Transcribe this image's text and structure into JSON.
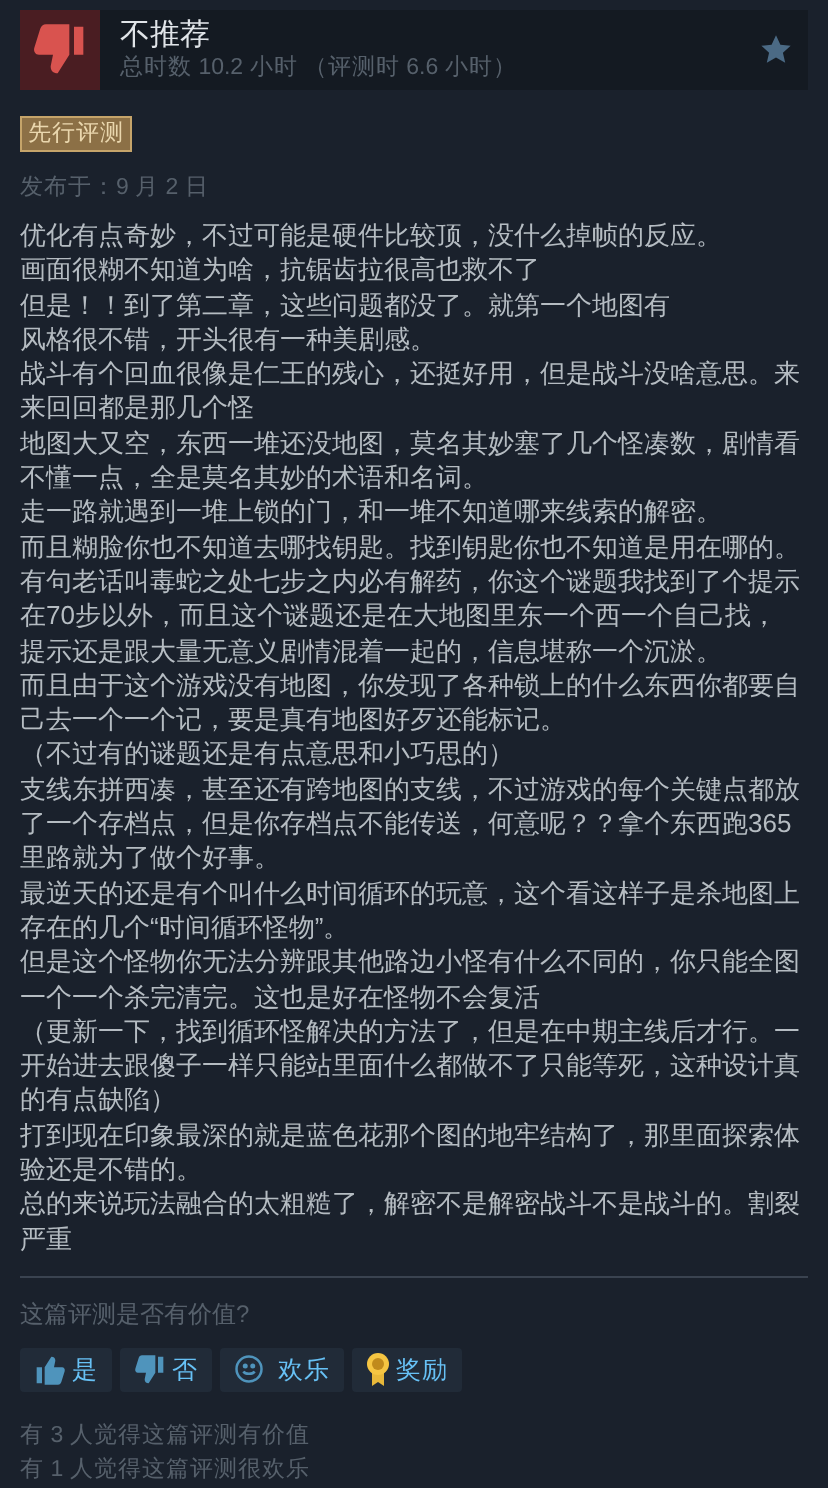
{
  "review": {
    "recommended": false,
    "verdict": "不推荐",
    "playtime": "总时数 10.2 小时 （评测时 6.6 小时）",
    "badge": "先行评测",
    "posted": "发布于：9 月 2 日",
    "paragraphs": [
      "优化有点奇妙，不过可能是硬件比较顶，没什么掉帧的反应。",
      "画面很糊不知道为啥，抗锯齿拉很高也救不了",
      "但是！！到了第二章，这些问题都没了。就第一个地图有",
      "风格很不错，开头很有一种美剧感。",
      "战斗有个回血很像是仁王的残心，还挺好用，但是战斗没啥意思。来来回回都是那几个怪",
      "地图大又空，东西一堆还没地图，莫名其妙塞了几个怪凑数，剧情看不懂一点，全是莫名其妙的术语和名词。",
      "走一路就遇到一堆上锁的门，和一堆不知道哪来线索的解密。",
      "而且糊脸你也不知道去哪找钥匙。找到钥匙你也不知道是用在哪的。",
      "有句老话叫毒蛇之处七步之内必有解药，你这个谜题我找到了个提示在70步以外，而且这个谜题还是在大地图里东一个西一个自己找，",
      "提示还是跟大量无意义剧情混着一起的，信息堪称一个沉淤。",
      "而且由于这个游戏没有地图，你发现了各种锁上的什么东西你都要自己去一个一个记，要是真有地图好歹还能标记。",
      "（不过有的谜题还是有点意思和小巧思的）",
      "支线东拼西凑，甚至还有跨地图的支线，不过游戏的每个关键点都放了一个存档点，但是你存档点不能传送，何意呢？？拿个东西跑365里路就为了做个好事。",
      "最逆天的还是有个叫什么时间循环的玩意，这个看这样子是杀地图上存在的几个“时间循环怪物”。",
      "但是这个怪物你无法分辨跟其他路边小怪有什么不同的，你只能全图一个一个杀完清完。这也是好在怪物不会复活",
      "（更新一下，找到循环怪解决的方法了，但是在中期主线后才行。一开始进去跟傻子一样只能站里面什么都做不了只能等死，这种设计真的有点缺陷）",
      "打到现在印象最深的就是蓝色花那个图的地牢结构了，那里面探索体验还是不错的。",
      "总的来说玩法融合的太粗糙了，解密不是解密战斗不是战斗的。割裂严重"
    ]
  },
  "feedback": {
    "prompt": "这篇评测是否有价值?",
    "buttons": [
      {
        "kind": "yes",
        "label": "是"
      },
      {
        "kind": "no",
        "label": "否"
      },
      {
        "kind": "funny",
        "label": "欢乐"
      },
      {
        "kind": "award",
        "label": "奖励"
      }
    ],
    "stats": [
      "有 3 人觉得这篇评测有价值",
      "有 1 人觉得这篇评测很欢乐"
    ]
  }
}
